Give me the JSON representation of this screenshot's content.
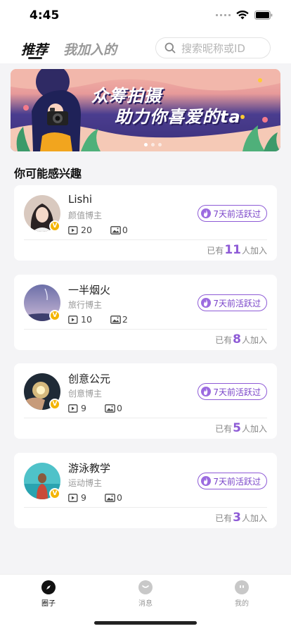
{
  "status_bar": {
    "time": "4:45"
  },
  "header": {
    "tabs": [
      {
        "label": "推荐",
        "active": true
      },
      {
        "label": "我加入的",
        "active": false
      }
    ],
    "search_placeholder": "搜索昵称或ID"
  },
  "banner": {
    "line1": "众筹拍摄",
    "line2": "助力你喜爱的ta",
    "page_count": 3,
    "active_page": 1
  },
  "section_title": "你可能感兴趣",
  "cards": [
    {
      "name": "Lishi",
      "role": "颜值博主",
      "videos": "20",
      "photos": "0",
      "activity": "7天前活跃过",
      "joined_prefix": "已有",
      "joined_count": "11",
      "joined_suffix": "人加入",
      "badge": "V"
    },
    {
      "name": "一半烟火",
      "role": "旅行博主",
      "videos": "10",
      "photos": "2",
      "activity": "7天前活跃过",
      "joined_prefix": "已有",
      "joined_count": "8",
      "joined_suffix": "人加入",
      "badge": "V"
    },
    {
      "name": "创意公元",
      "role": "创意博主",
      "videos": "9",
      "photos": "0",
      "activity": "7天前活跃过",
      "joined_prefix": "已有",
      "joined_count": "5",
      "joined_suffix": "人加入",
      "badge": "V"
    },
    {
      "name": "游泳教学",
      "role": "运动博主",
      "videos": "9",
      "photos": "0",
      "activity": "7天前活跃过",
      "joined_prefix": "已有",
      "joined_count": "3",
      "joined_suffix": "人加入",
      "badge": "V"
    }
  ],
  "tab_bar": [
    {
      "label": "圈子",
      "icon": "compass-icon",
      "active": true
    },
    {
      "label": "消息",
      "icon": "chat-icon",
      "active": false
    },
    {
      "label": "我的",
      "icon": "profile-icon",
      "active": false
    }
  ],
  "colors": {
    "accent": "#8e5bd6",
    "badge_gold": "#f4b400",
    "inactive_tab": "#999999"
  }
}
